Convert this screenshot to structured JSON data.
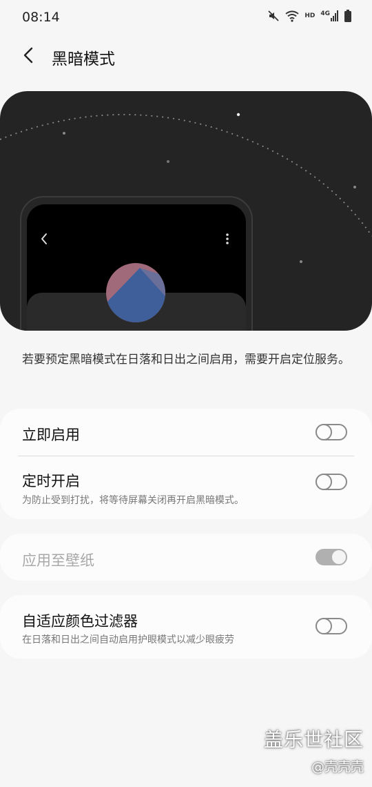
{
  "status": {
    "time": "08:14",
    "hd": "HD",
    "network": "4G"
  },
  "header": {
    "title": "黑暗模式"
  },
  "info": {
    "text": "若要预定黑暗模式在日落和日出之间启用，需要开启定位服务。"
  },
  "settings": {
    "enable_now": {
      "label": "立即启用",
      "state": "off"
    },
    "scheduled": {
      "label": "定时开启",
      "description": "为防止受到打扰，将等待屏幕关闭再开启黑暗模式。",
      "state": "off"
    },
    "apply_wallpaper": {
      "label": "应用至壁纸",
      "state": "on",
      "enabled": false
    },
    "adaptive_filter": {
      "label": "自适应颜色过滤器",
      "description": "在日落和日出之间自动启用护眼模式以减少眼疲劳",
      "state": "off"
    }
  },
  "watermark": {
    "line1": "盖乐世社区",
    "line2": "@壳壳壳"
  },
  "colors": {
    "background": "#f6f6f6",
    "hero": "#242424",
    "moon": "#f5c400",
    "card": "#fcfcfc"
  },
  "icons": [
    "mute-icon",
    "wifi-icon",
    "signal-icon",
    "battery-icon",
    "back-arrow-icon",
    "more-vertical-icon",
    "moon-icon"
  ]
}
